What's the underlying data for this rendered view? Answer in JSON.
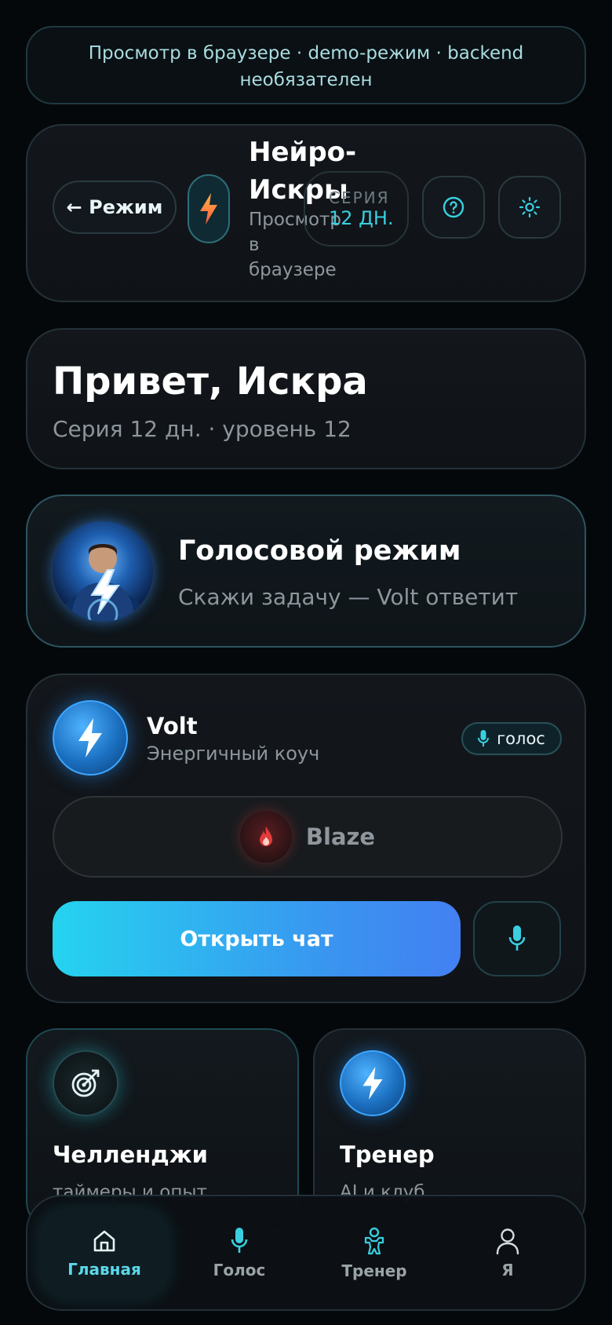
{
  "banner": {
    "line1": "Просмотр в браузере · demo-режим · backend",
    "line2": "необязателен"
  },
  "header": {
    "back_label": "← Режим",
    "app_title": "Нейро-Искры",
    "app_subtitle": "Просмотр в браузере",
    "streak_label": "СЕРИЯ",
    "streak_value": "12 ДН."
  },
  "greeting": {
    "title": "Привет, Искра",
    "subtitle": "Серия 12 дн. · уровень 12"
  },
  "voice_mode": {
    "title": "Голосовой режим",
    "subtitle": "Скажи задачу — Volt ответит"
  },
  "coach": {
    "name": "Volt",
    "role": "Энергичный коуч",
    "voice_chip": "голос",
    "alt_coach": "Blaze",
    "open_chat": "Открыть чат"
  },
  "tiles": [
    {
      "title": "Челленджи",
      "subtitle": "таймеры и опыт"
    },
    {
      "title": "Тренер",
      "subtitle": "AI и клуб"
    }
  ],
  "nav": [
    {
      "label": "Главная",
      "icon": "home-icon",
      "active": true
    },
    {
      "label": "Голос",
      "icon": "mic-icon"
    },
    {
      "label": "Тренер",
      "icon": "trainer-icon"
    },
    {
      "label": "Я",
      "icon": "user-icon"
    }
  ],
  "colors": {
    "accent": "#39cfe0",
    "gradient_start": "#25d3ef",
    "gradient_end": "#4380f2",
    "bg": "#05080b"
  }
}
